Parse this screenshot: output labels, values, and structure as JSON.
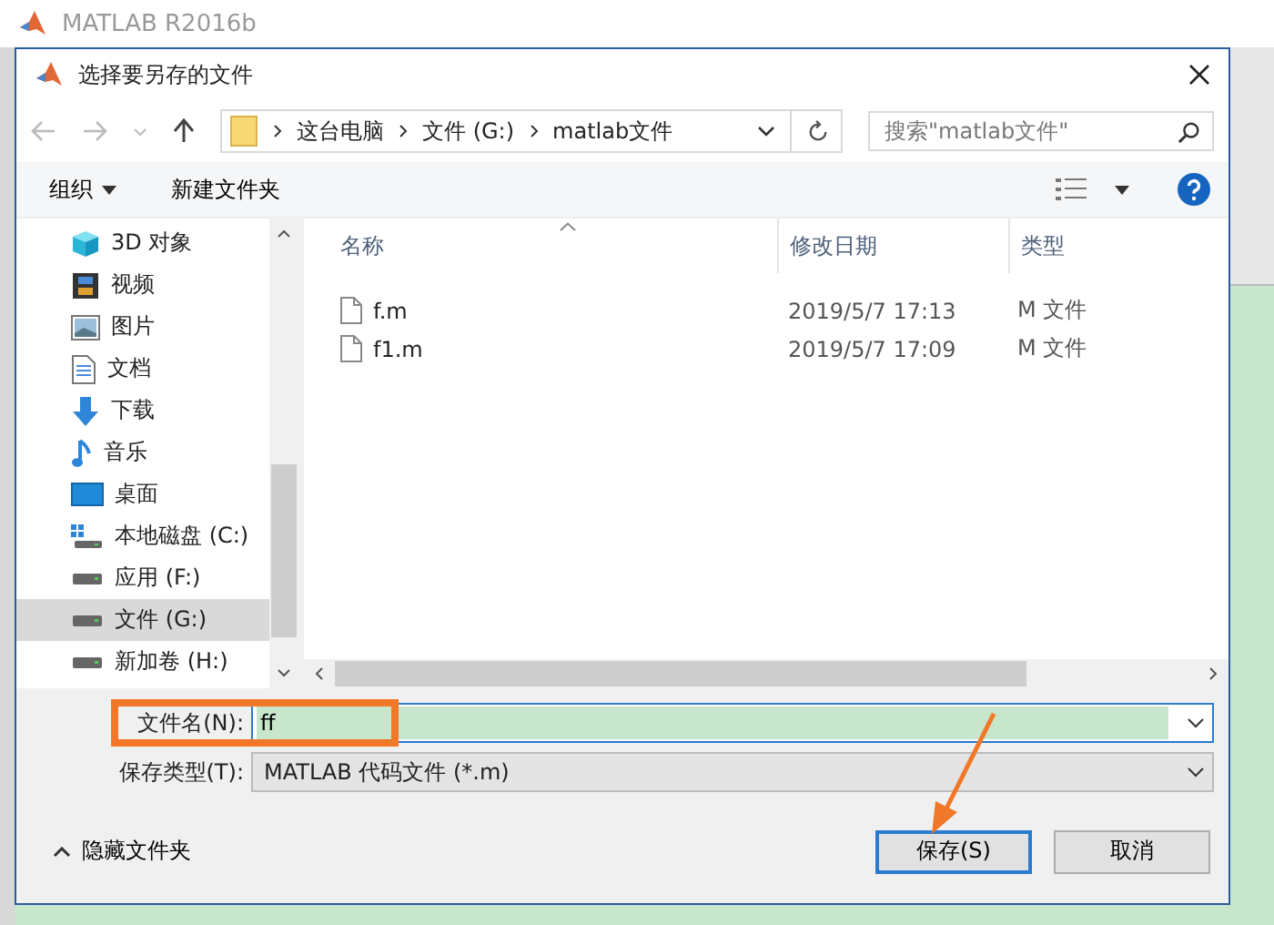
{
  "app_window": {
    "title": "MATLAB R2016b"
  },
  "dialog": {
    "title": "选择要另存的文件",
    "breadcrumb": [
      "这台电脑",
      "文件 (G:)",
      "matlab文件"
    ],
    "search": {
      "placeholder": "搜索\"matlab文件\""
    },
    "toolbar": {
      "organize": "组织",
      "new_folder": "新建文件夹"
    },
    "sidebar": {
      "items": [
        {
          "label": "3D 对象",
          "kind": "cube",
          "selected": false
        },
        {
          "label": "视频",
          "kind": "film",
          "selected": false
        },
        {
          "label": "图片",
          "kind": "picture",
          "selected": false
        },
        {
          "label": "文档",
          "kind": "document",
          "selected": false
        },
        {
          "label": "下载",
          "kind": "download",
          "selected": false
        },
        {
          "label": "音乐",
          "kind": "music",
          "selected": false
        },
        {
          "label": "桌面",
          "kind": "desktop",
          "selected": false
        },
        {
          "label": "本地磁盘 (C:)",
          "kind": "system-drive",
          "selected": false
        },
        {
          "label": "应用 (F:)",
          "kind": "drive",
          "selected": false
        },
        {
          "label": "文件 (G:)",
          "kind": "drive",
          "selected": true
        },
        {
          "label": "新加卷 (H:)",
          "kind": "drive",
          "selected": false
        }
      ]
    },
    "table": {
      "columns": [
        "名称",
        "修改日期",
        "类型"
      ],
      "rows": [
        {
          "name": "f.m",
          "modified": "2019/5/7 17:13",
          "type": "M 文件"
        },
        {
          "name": "f1.m",
          "modified": "2019/5/7 17:09",
          "type": "M 文件"
        }
      ]
    },
    "filename": {
      "label": "文件名(N):",
      "value": "ff"
    },
    "filetype": {
      "label": "保存类型(T):",
      "value": "MATLAB 代码文件 (*.m)"
    },
    "hide_folders": "隐藏文件夹",
    "buttons": [
      {
        "label": "保存(S)",
        "kind": "primary"
      },
      {
        "label": "取消",
        "kind": "normal"
      }
    ]
  }
}
